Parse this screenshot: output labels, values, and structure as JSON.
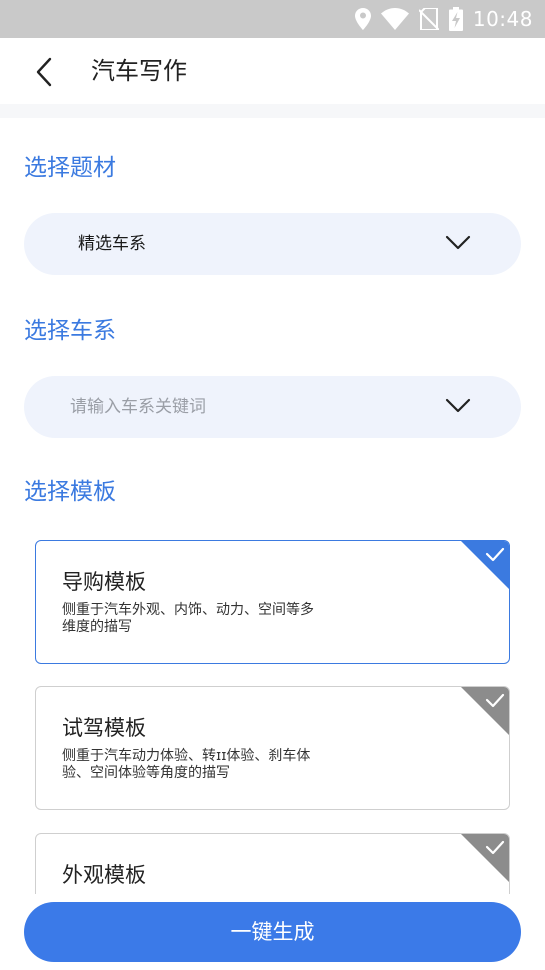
{
  "status_bar": {
    "time": "10:48",
    "icons": [
      "location-icon",
      "wifi-icon",
      "no-sim-icon",
      "battery-charging-icon"
    ]
  },
  "header": {
    "back_icon": "chevron-left-icon",
    "title": "汽车写作"
  },
  "colors": {
    "accent": "#3b7ae0",
    "button": "#3b7ae8",
    "dropdown_bg": "#eff3fc",
    "unselected_corner": "#8c8c8c"
  },
  "sections": {
    "topic": {
      "title": "选择题材",
      "dropdown_value": "精选车系"
    },
    "series": {
      "title": "选择车系",
      "placeholder": "请输入车系关键词"
    },
    "template": {
      "title": "选择模板",
      "cards": [
        {
          "title": "导购模板",
          "desc_line1": "侧重于汽车外观、内饰、动力、空间等多",
          "desc_line2": "维度的描写",
          "selected": true
        },
        {
          "title": "试驾模板",
          "desc_line1": "侧重于汽车动力体验、转ɪɪ体验、刹车体",
          "desc_line2": "验、空间体验等角度的描写",
          "selected": false
        },
        {
          "title": "外观模板",
          "selected": false
        }
      ]
    }
  },
  "generate_button": {
    "label": "一键生成"
  }
}
